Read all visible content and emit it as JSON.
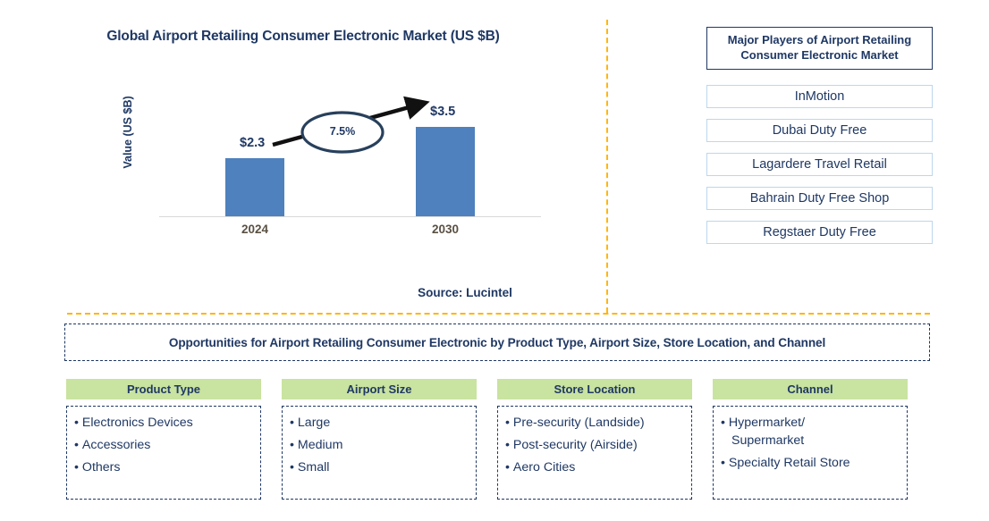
{
  "chart_panel": {
    "title": "Global Airport Retailing Consumer Electronic Market (US $B)",
    "y_axis_label": "Value (US $B)",
    "cagr_label": "7.5%",
    "source": "Source: Lucintel"
  },
  "chart_data": {
    "type": "bar",
    "title": "Global Airport Retailing Consumer Electronic Market (US $B)",
    "categories": [
      "2024",
      "2030"
    ],
    "values": [
      2.3,
      3.5
    ],
    "data_labels": [
      "$2.3",
      "$3.5"
    ],
    "xlabel": "",
    "ylabel": "Value (US $B)",
    "ylim": [
      0,
      4.0
    ],
    "grid": false,
    "legend": "none",
    "series_color": "#4E81BD",
    "annotations": [
      {
        "type": "cagr-arrow",
        "label": "7.5%",
        "from_category": "2024",
        "to_category": "2030"
      }
    ]
  },
  "players_panel": {
    "title": "Major Players of Airport Retailing Consumer Electronic Market",
    "players": [
      "InMotion",
      "Dubai Duty Free",
      "Lagardere Travel Retail",
      "Bahrain Duty Free Shop",
      "Regstaer Duty Free"
    ]
  },
  "opportunities": {
    "header": "Opportunities for Airport Retailing Consumer Electronic by Product Type, Airport Size, Store Location, and Channel",
    "columns": [
      {
        "header": "Product Type",
        "items": [
          "Electronics Devices",
          "Accessories",
          "Others"
        ]
      },
      {
        "header": "Airport Size",
        "items": [
          "Large",
          "Medium",
          "Small"
        ]
      },
      {
        "header": "Store Location",
        "items": [
          "Pre-security (Landside)",
          "Post-security (Airside)",
          "Aero Cities"
        ]
      },
      {
        "header": "Channel",
        "items": [
          "Hypermarket/\nSupermarket",
          "Specialty Retail Store"
        ]
      }
    ]
  },
  "colors": {
    "bar": "#4E81BD",
    "navy": "#1F3864",
    "green_header": "#C9E3A0",
    "divider_orange": "#FFB511",
    "player_border": "#BDD7EE"
  }
}
